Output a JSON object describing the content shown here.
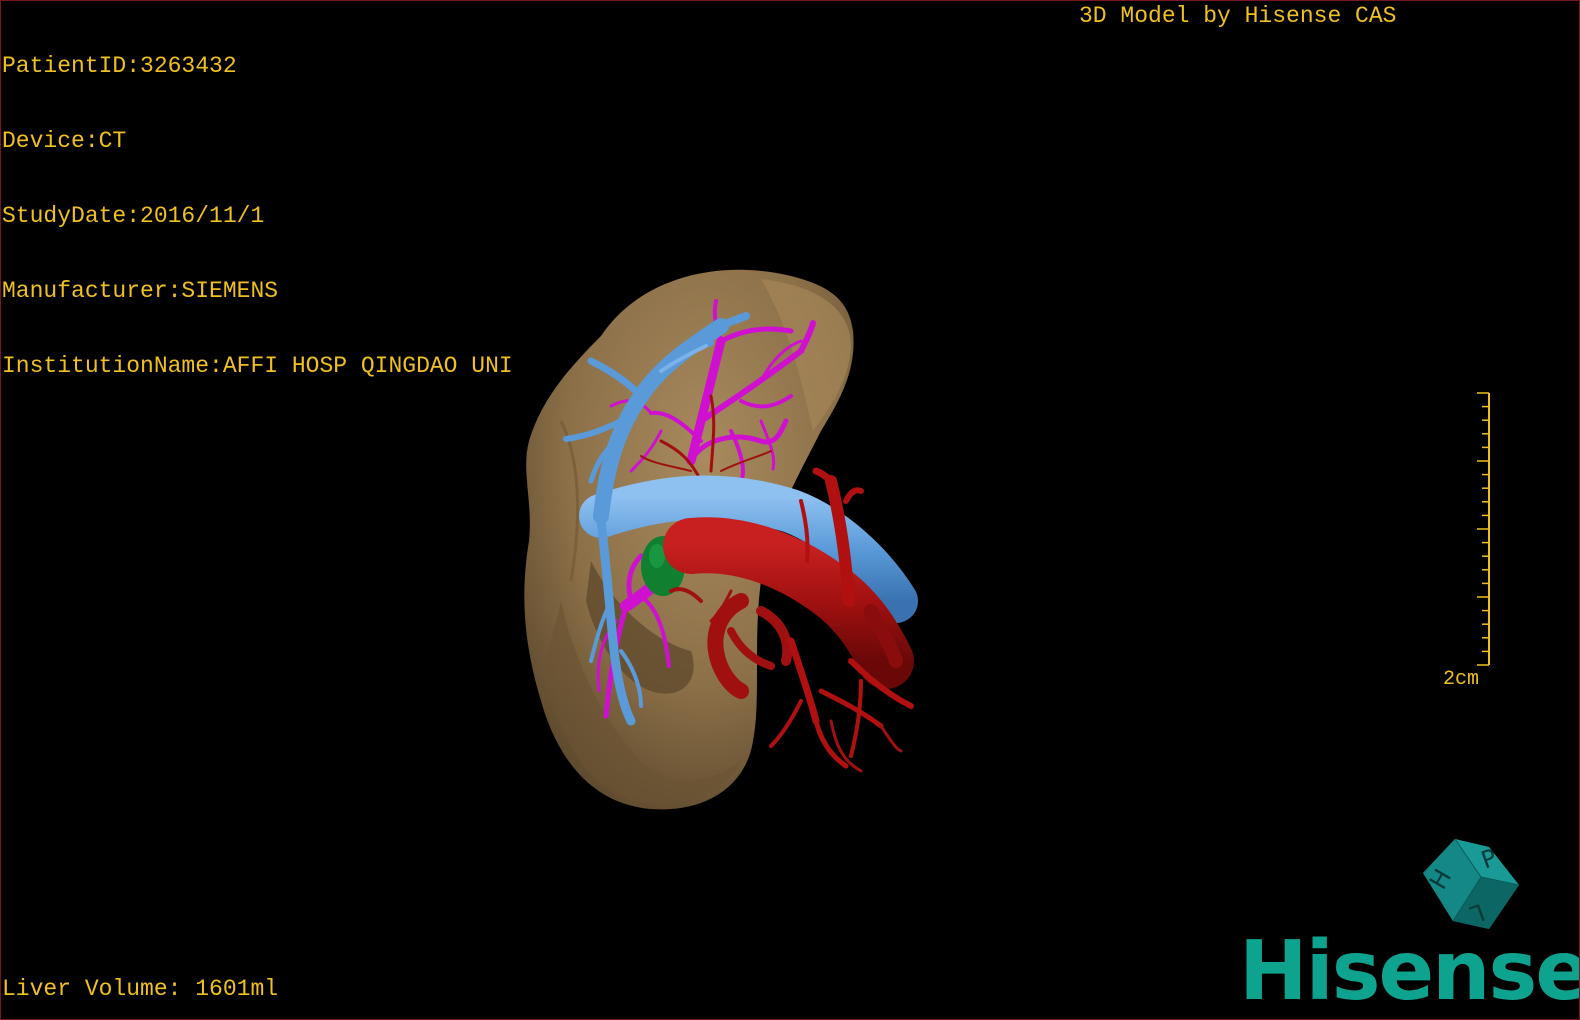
{
  "patient_info": {
    "patient_id": "PatientID:3263432",
    "device": "Device:CT",
    "study_date": "StudyDate:2016/11/1",
    "manufacturer": "Manufacturer:SIEMENS",
    "institution": "InstitutionName:AFFI HOSP QINGDAO UNI"
  },
  "model_credit": "3D Model by Hisense CAS",
  "liver_volume": "Liver Volume: 1601ml",
  "scale_bar": {
    "label": "2cm"
  },
  "orientation_cube": {
    "icon": "orientation-cube-icon",
    "faces": [
      "P",
      "H",
      "L"
    ]
  },
  "brand": {
    "logo_text": "Hisense"
  },
  "colors": {
    "overlay_text": "#f0c020",
    "liver": "#8c7048",
    "portal_vein": "#5a9ad8",
    "hepatic_vein": "#d010d0",
    "artery": "#b01010",
    "gallbladder": "#108030",
    "brand": "#0ea38e",
    "frame": "#7a1420"
  },
  "structures": [
    "liver",
    "portal-vein",
    "hepatic-vein",
    "artery",
    "gallbladder"
  ]
}
